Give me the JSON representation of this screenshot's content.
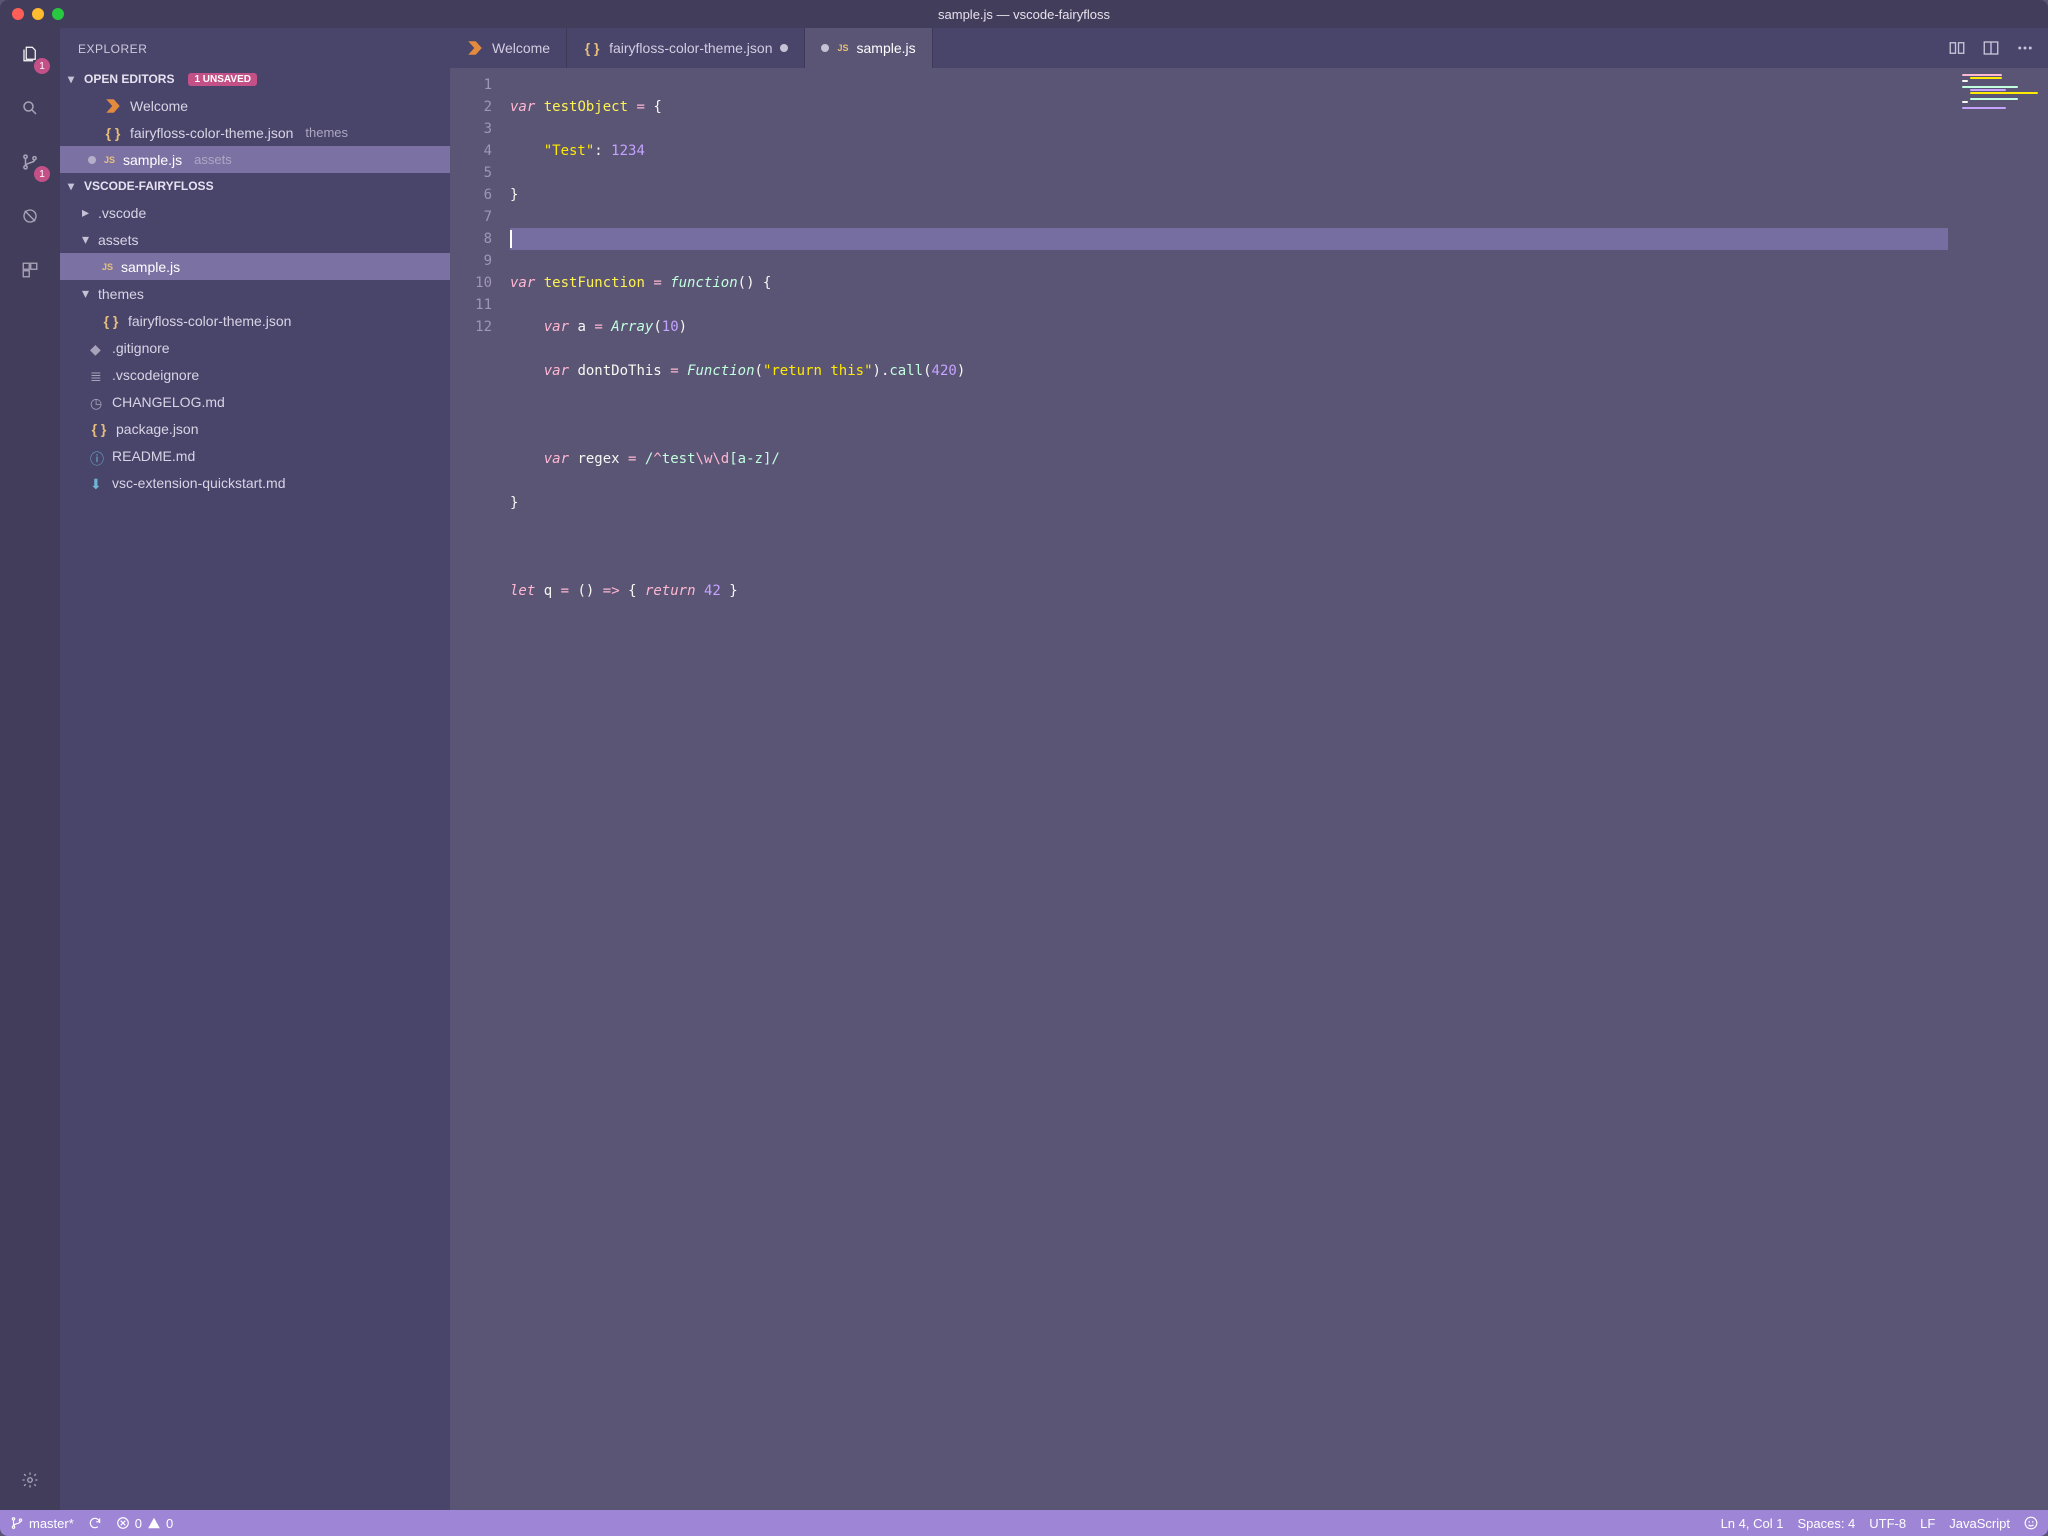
{
  "title": "sample.js — vscode-fairyfloss",
  "activitybar": {
    "explorer_badge": "1",
    "scm_badge": "1"
  },
  "sidebar": {
    "title": "EXPLORER",
    "open_editors": {
      "header": "OPEN EDITORS",
      "unsaved_badge": "1 UNSAVED",
      "items": [
        {
          "label": "Welcome",
          "icon": "welcome",
          "modified": false
        },
        {
          "label": "fairyfloss-color-theme.json",
          "sub": "themes",
          "icon": "json",
          "modified": false
        },
        {
          "label": "sample.js",
          "sub": "assets",
          "icon": "js",
          "modified": true,
          "selected": true
        }
      ]
    },
    "project": {
      "header": "VSCODE-FAIRYFLOSS",
      "tree": [
        {
          "kind": "folder",
          "label": ".vscode",
          "depth": 0,
          "expanded": false
        },
        {
          "kind": "folder",
          "label": "assets",
          "depth": 0,
          "expanded": true
        },
        {
          "kind": "file",
          "label": "sample.js",
          "icon": "js",
          "depth": 1,
          "selected": true
        },
        {
          "kind": "folder",
          "label": "themes",
          "depth": 0,
          "expanded": true
        },
        {
          "kind": "file",
          "label": "fairyfloss-color-theme.json",
          "icon": "json",
          "depth": 1
        },
        {
          "kind": "file",
          "label": ".gitignore",
          "icon": "git",
          "depth": 0
        },
        {
          "kind": "file",
          "label": ".vscodeignore",
          "icon": "lines",
          "depth": 0
        },
        {
          "kind": "file",
          "label": "CHANGELOG.md",
          "icon": "clock",
          "depth": 0
        },
        {
          "kind": "file",
          "label": "package.json",
          "icon": "json",
          "depth": 0
        },
        {
          "kind": "file",
          "label": "README.md",
          "icon": "info",
          "depth": 0
        },
        {
          "kind": "file",
          "label": "vsc-extension-quickstart.md",
          "icon": "arrow",
          "depth": 0
        }
      ]
    }
  },
  "tabs": [
    {
      "label": "Welcome",
      "icon": "welcome",
      "modified": false
    },
    {
      "label": "fairyfloss-color-theme.json",
      "icon": "json",
      "modified": true
    },
    {
      "label": "sample.js",
      "icon": "js",
      "modified": true,
      "active": true
    }
  ],
  "statusbar": {
    "branch": "master*",
    "errors": "0",
    "warnings": "0",
    "position": "Ln 4, Col 1",
    "spaces": "Spaces: 4",
    "encoding": "UTF-8",
    "eol": "LF",
    "language": "JavaScript"
  },
  "code": {
    "line_count": 12,
    "current_line": 4,
    "raw": [
      "var testObject = {",
      "    \"Test\": 1234",
      "}",
      "",
      "var testFunction = function() {",
      "    var a = Array(10)",
      "    var dontDoThis = Function(\"return this\").call(420)",
      "",
      "    var regex = /^test\\w\\d[a-z]/",
      "}",
      "",
      "let q = () => { return 42 }"
    ]
  }
}
